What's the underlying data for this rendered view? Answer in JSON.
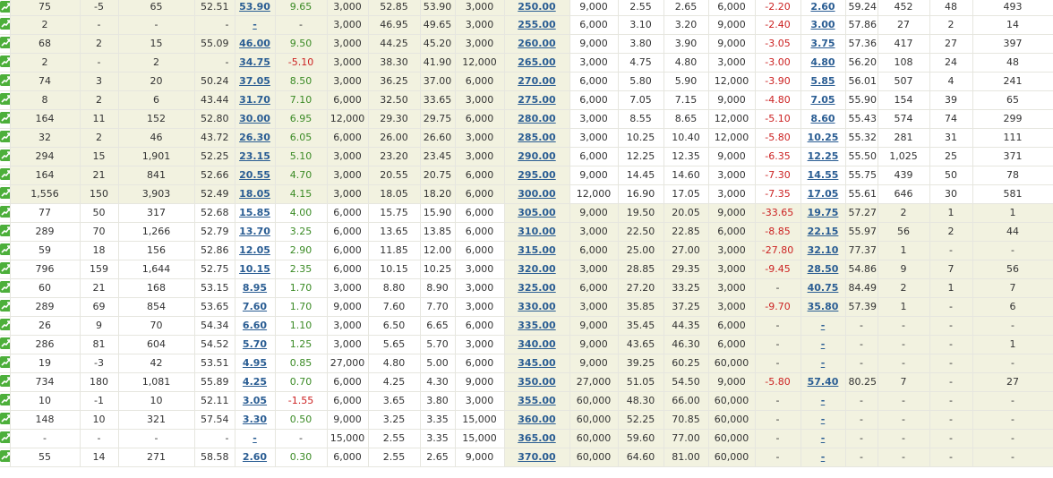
{
  "colors": {
    "link": "#2a5d93",
    "positive": "#3a8a24",
    "negative": "#cc2222",
    "itm_background": "#f2f2e0",
    "icon": "#4caf3a"
  },
  "chart_icon": "trend-chart-icon",
  "rows": [
    {
      "call": [
        "75",
        "-5",
        "65",
        "52.51",
        "53.90",
        "9.65",
        "3,000",
        "52.85",
        "53.90",
        "3,000"
      ],
      "call_chg_dir": "pos",
      "call_itm": true,
      "strike": "250.00",
      "put": [
        "9,000",
        "2.55",
        "2.65",
        "6,000",
        "-2.20",
        "2.60",
        "59.24",
        "452",
        "48",
        "493"
      ],
      "put_itm": false
    },
    {
      "call": [
        "2",
        "-",
        "-",
        "-",
        "-",
        "-",
        "3,000",
        "46.95",
        "49.65",
        "3,000"
      ],
      "call_chg_dir": "",
      "call_itm": true,
      "strike": "255.00",
      "put": [
        "6,000",
        "3.10",
        "3.20",
        "9,000",
        "-2.40",
        "3.00",
        "57.86",
        "27",
        "2",
        "14"
      ],
      "put_itm": false
    },
    {
      "call": [
        "68",
        "2",
        "15",
        "55.09",
        "46.00",
        "9.50",
        "3,000",
        "44.25",
        "45.20",
        "3,000"
      ],
      "call_chg_dir": "pos",
      "call_itm": true,
      "strike": "260.00",
      "put": [
        "9,000",
        "3.80",
        "3.90",
        "9,000",
        "-3.05",
        "3.75",
        "57.36",
        "417",
        "27",
        "397"
      ],
      "put_itm": false
    },
    {
      "call": [
        "2",
        "-",
        "2",
        "-",
        "34.75",
        "-5.10",
        "3,000",
        "38.30",
        "41.90",
        "12,000"
      ],
      "call_chg_dir": "neg",
      "call_itm": true,
      "strike": "265.00",
      "put": [
        "3,000",
        "4.75",
        "4.80",
        "3,000",
        "-3.00",
        "4.80",
        "56.20",
        "108",
        "24",
        "48"
      ],
      "put_itm": false
    },
    {
      "call": [
        "74",
        "3",
        "20",
        "50.24",
        "37.05",
        "8.50",
        "3,000",
        "36.25",
        "37.00",
        "6,000"
      ],
      "call_chg_dir": "pos",
      "call_itm": true,
      "strike": "270.00",
      "put": [
        "6,000",
        "5.80",
        "5.90",
        "12,000",
        "-3.90",
        "5.85",
        "56.01",
        "507",
        "4",
        "241"
      ],
      "put_itm": false
    },
    {
      "call": [
        "8",
        "2",
        "6",
        "43.44",
        "31.70",
        "7.10",
        "6,000",
        "32.50",
        "33.65",
        "3,000"
      ],
      "call_chg_dir": "pos",
      "call_itm": true,
      "strike": "275.00",
      "put": [
        "6,000",
        "7.05",
        "7.15",
        "9,000",
        "-4.80",
        "7.05",
        "55.90",
        "154",
        "39",
        "65"
      ],
      "put_itm": false
    },
    {
      "call": [
        "164",
        "11",
        "152",
        "52.80",
        "30.00",
        "6.95",
        "12,000",
        "29.30",
        "29.75",
        "6,000"
      ],
      "call_chg_dir": "pos",
      "call_itm": true,
      "strike": "280.00",
      "put": [
        "3,000",
        "8.55",
        "8.65",
        "12,000",
        "-5.10",
        "8.60",
        "55.43",
        "574",
        "74",
        "299"
      ],
      "put_itm": false
    },
    {
      "call": [
        "32",
        "2",
        "46",
        "43.72",
        "26.30",
        "6.05",
        "6,000",
        "26.00",
        "26.60",
        "3,000"
      ],
      "call_chg_dir": "pos",
      "call_itm": true,
      "strike": "285.00",
      "put": [
        "3,000",
        "10.25",
        "10.40",
        "12,000",
        "-5.80",
        "10.25",
        "55.32",
        "281",
        "31",
        "111"
      ],
      "put_itm": false
    },
    {
      "call": [
        "294",
        "15",
        "1,901",
        "52.25",
        "23.15",
        "5.10",
        "3,000",
        "23.20",
        "23.45",
        "3,000"
      ],
      "call_chg_dir": "pos",
      "call_itm": true,
      "strike": "290.00",
      "put": [
        "6,000",
        "12.25",
        "12.35",
        "9,000",
        "-6.35",
        "12.25",
        "55.50",
        "1,025",
        "25",
        "371"
      ],
      "put_itm": false
    },
    {
      "call": [
        "164",
        "21",
        "841",
        "52.66",
        "20.55",
        "4.70",
        "3,000",
        "20.55",
        "20.75",
        "6,000"
      ],
      "call_chg_dir": "pos",
      "call_itm": true,
      "strike": "295.00",
      "put": [
        "9,000",
        "14.45",
        "14.60",
        "3,000",
        "-7.30",
        "14.55",
        "55.75",
        "439",
        "50",
        "78"
      ],
      "put_itm": false
    },
    {
      "call": [
        "1,556",
        "150",
        "3,903",
        "52.49",
        "18.05",
        "4.15",
        "3,000",
        "18.05",
        "18.20",
        "6,000"
      ],
      "call_chg_dir": "pos",
      "call_itm": true,
      "strike": "300.00",
      "put": [
        "12,000",
        "16.90",
        "17.05",
        "3,000",
        "-7.35",
        "17.05",
        "55.61",
        "646",
        "30",
        "581"
      ],
      "put_itm": false
    },
    {
      "call": [
        "77",
        "50",
        "317",
        "52.68",
        "15.85",
        "4.00",
        "6,000",
        "15.75",
        "15.90",
        "6,000"
      ],
      "call_chg_dir": "pos",
      "call_itm": false,
      "strike": "305.00",
      "put": [
        "9,000",
        "19.50",
        "20.05",
        "9,000",
        "-33.65",
        "19.75",
        "57.27",
        "2",
        "1",
        "1"
      ],
      "put_itm": true
    },
    {
      "call": [
        "289",
        "70",
        "1,266",
        "52.79",
        "13.70",
        "3.25",
        "6,000",
        "13.65",
        "13.85",
        "6,000"
      ],
      "call_chg_dir": "pos",
      "call_itm": false,
      "strike": "310.00",
      "put": [
        "3,000",
        "22.50",
        "22.85",
        "6,000",
        "-8.85",
        "22.15",
        "55.97",
        "56",
        "2",
        "44"
      ],
      "put_itm": true
    },
    {
      "call": [
        "59",
        "18",
        "156",
        "52.86",
        "12.05",
        "2.90",
        "6,000",
        "11.85",
        "12.00",
        "6,000"
      ],
      "call_chg_dir": "pos",
      "call_itm": false,
      "strike": "315.00",
      "put": [
        "6,000",
        "25.00",
        "27.00",
        "3,000",
        "-27.80",
        "32.10",
        "77.37",
        "1",
        "-",
        "-"
      ],
      "put_itm": true
    },
    {
      "call": [
        "796",
        "159",
        "1,644",
        "52.75",
        "10.15",
        "2.35",
        "6,000",
        "10.15",
        "10.25",
        "3,000"
      ],
      "call_chg_dir": "pos",
      "call_itm": false,
      "strike": "320.00",
      "put": [
        "3,000",
        "28.85",
        "29.35",
        "3,000",
        "-9.45",
        "28.50",
        "54.86",
        "9",
        "7",
        "56"
      ],
      "put_itm": true
    },
    {
      "call": [
        "60",
        "21",
        "168",
        "53.15",
        "8.95",
        "1.70",
        "3,000",
        "8.80",
        "8.90",
        "3,000"
      ],
      "call_chg_dir": "pos",
      "call_itm": false,
      "strike": "325.00",
      "put": [
        "6,000",
        "27.20",
        "33.25",
        "3,000",
        "-",
        "40.75",
        "84.49",
        "2",
        "1",
        "7"
      ],
      "put_itm": true
    },
    {
      "call": [
        "289",
        "69",
        "854",
        "53.65",
        "7.60",
        "1.70",
        "9,000",
        "7.60",
        "7.70",
        "3,000"
      ],
      "call_chg_dir": "pos",
      "call_itm": false,
      "strike": "330.00",
      "put": [
        "3,000",
        "35.85",
        "37.25",
        "3,000",
        "-9.70",
        "35.80",
        "57.39",
        "1",
        "-",
        "6"
      ],
      "put_itm": true
    },
    {
      "call": [
        "26",
        "9",
        "70",
        "54.34",
        "6.60",
        "1.10",
        "3,000",
        "6.50",
        "6.65",
        "6,000"
      ],
      "call_chg_dir": "pos",
      "call_itm": false,
      "strike": "335.00",
      "put": [
        "9,000",
        "35.45",
        "44.35",
        "6,000",
        "-",
        "-",
        "-",
        "-",
        "-",
        "-"
      ],
      "put_itm": true
    },
    {
      "call": [
        "286",
        "81",
        "604",
        "54.52",
        "5.70",
        "1.25",
        "3,000",
        "5.65",
        "5.70",
        "3,000"
      ],
      "call_chg_dir": "pos",
      "call_itm": false,
      "strike": "340.00",
      "put": [
        "9,000",
        "43.65",
        "46.30",
        "6,000",
        "-",
        "-",
        "-",
        "-",
        "-",
        "1"
      ],
      "put_itm": true
    },
    {
      "call": [
        "19",
        "-3",
        "42",
        "53.51",
        "4.95",
        "0.85",
        "27,000",
        "4.80",
        "5.00",
        "6,000"
      ],
      "call_chg_dir": "pos",
      "call_itm": false,
      "strike": "345.00",
      "put": [
        "9,000",
        "39.25",
        "60.25",
        "60,000",
        "-",
        "-",
        "-",
        "-",
        "-",
        "-"
      ],
      "put_itm": true
    },
    {
      "call": [
        "734",
        "180",
        "1,081",
        "55.89",
        "4.25",
        "0.70",
        "6,000",
        "4.25",
        "4.30",
        "9,000"
      ],
      "call_chg_dir": "pos",
      "call_itm": false,
      "strike": "350.00",
      "put": [
        "27,000",
        "51.05",
        "54.50",
        "9,000",
        "-5.80",
        "57.40",
        "80.25",
        "7",
        "-",
        "27"
      ],
      "put_itm": true
    },
    {
      "call": [
        "10",
        "-1",
        "10",
        "52.11",
        "3.05",
        "-1.55",
        "6,000",
        "3.65",
        "3.80",
        "3,000"
      ],
      "call_chg_dir": "neg",
      "call_itm": false,
      "strike": "355.00",
      "put": [
        "60,000",
        "48.30",
        "66.00",
        "60,000",
        "-",
        "-",
        "-",
        "-",
        "-",
        "-"
      ],
      "put_itm": true
    },
    {
      "call": [
        "148",
        "10",
        "321",
        "57.54",
        "3.30",
        "0.50",
        "9,000",
        "3.25",
        "3.35",
        "15,000"
      ],
      "call_chg_dir": "pos",
      "call_itm": false,
      "strike": "360.00",
      "put": [
        "60,000",
        "52.25",
        "70.85",
        "60,000",
        "-",
        "-",
        "-",
        "-",
        "-",
        "-"
      ],
      "put_itm": true
    },
    {
      "call": [
        "-",
        "-",
        "-",
        "-",
        "-",
        "-",
        "15,000",
        "2.55",
        "3.35",
        "15,000"
      ],
      "call_chg_dir": "",
      "call_itm": false,
      "strike": "365.00",
      "put": [
        "60,000",
        "59.60",
        "77.00",
        "60,000",
        "-",
        "-",
        "-",
        "-",
        "-",
        "-"
      ],
      "put_itm": true
    },
    {
      "call": [
        "55",
        "14",
        "271",
        "58.58",
        "2.60",
        "0.30",
        "6,000",
        "2.55",
        "2.65",
        "9,000"
      ],
      "call_chg_dir": "pos",
      "call_itm": false,
      "strike": "370.00",
      "put": [
        "60,000",
        "64.60",
        "81.00",
        "60,000",
        "-",
        "-",
        "-",
        "-",
        "-",
        "-"
      ],
      "put_itm": true
    }
  ]
}
